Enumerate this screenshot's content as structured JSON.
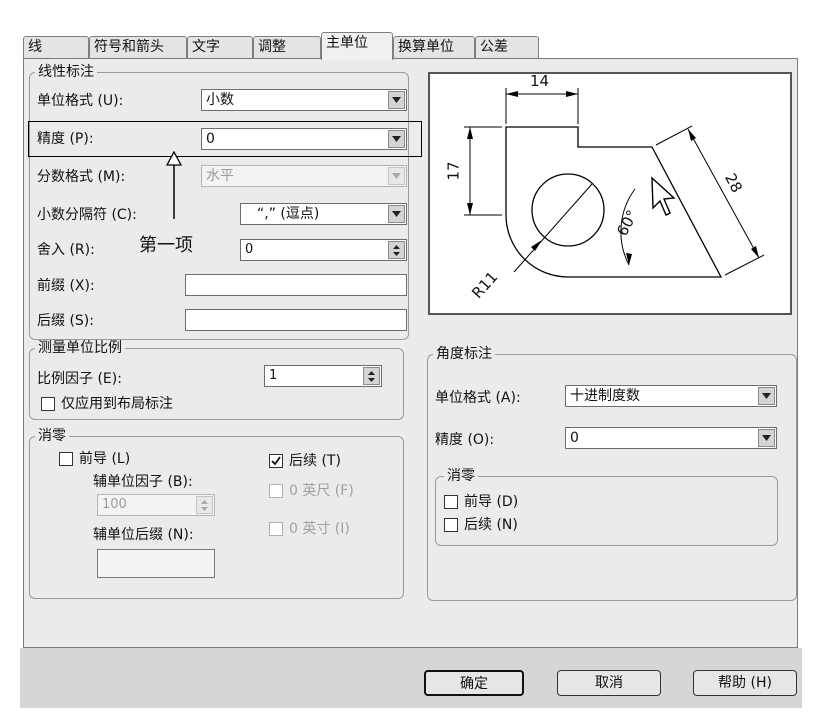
{
  "tabs": [
    {
      "label": "线"
    },
    {
      "label": "符号和箭头"
    },
    {
      "label": "文字"
    },
    {
      "label": "调整"
    },
    {
      "label": "主单位",
      "active": true
    },
    {
      "label": "换算单位"
    },
    {
      "label": "公差"
    }
  ],
  "linear": {
    "title": "线性标注",
    "unit_format_label": "单位格式 (U):",
    "unit_format_value": "小数",
    "precision_label": "精度 (P):",
    "precision_value": "0",
    "fraction_format_label": "分数格式 (M):",
    "fraction_format_value": "水平",
    "decimal_sep_label": "小数分隔符 (C):",
    "decimal_sep_value": "“,” (逗点)",
    "round_label": "舍入 (R):",
    "round_value": "0",
    "prefix_label": "前缀 (X):",
    "suffix_label": "后缀 (S):",
    "annotation": "第一项"
  },
  "scale": {
    "title": "测量单位比例",
    "factor_label": "比例因子 (E):",
    "factor_value": "1",
    "layout_only_label": "仅应用到布局标注"
  },
  "zero_linear": {
    "title": "消零",
    "leading_label": "前导 (L)",
    "trailing_label": "后续 (T)",
    "sub_factor_label": "辅单位因子 (B):",
    "sub_factor_value": "100",
    "sub_suffix_label": "辅单位后缀 (N):",
    "feet_label": "0 英尺 (F)",
    "inches_label": "0 英寸 (I)"
  },
  "angular": {
    "title": "角度标注",
    "unit_format_label": "单位格式 (A):",
    "unit_format_value": "十进制度数",
    "precision_label": "精度 (O):",
    "precision_value": "0",
    "zero_title": "消零",
    "leading_label": "前导 (D)",
    "trailing_label": "后续 (N)"
  },
  "preview": {
    "dim_top": "14",
    "dim_left": "17",
    "dim_diag": "28",
    "dim_angle": "60°",
    "dim_radius": "R11"
  },
  "buttons": {
    "ok": "确定",
    "cancel": "取消",
    "help": "帮助 (H)"
  }
}
